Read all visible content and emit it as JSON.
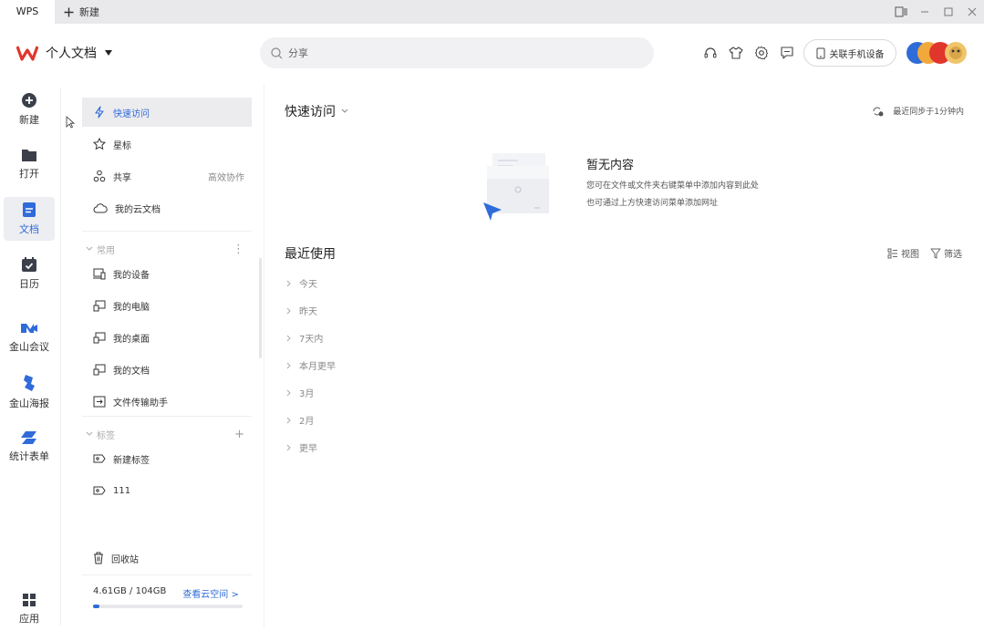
{
  "tabs": {
    "app_tab": "WPS",
    "new_tab": "新建"
  },
  "header": {
    "workspace": "个人文档",
    "search_placeholder": "分享",
    "link_phone": "关联手机设备"
  },
  "rail": [
    {
      "label": "新建",
      "icon": "plus-circle-icon"
    },
    {
      "label": "打开",
      "icon": "folder-icon"
    },
    {
      "label": "文档",
      "icon": "document-icon",
      "active": true
    },
    {
      "label": "日历",
      "icon": "calendar-icon"
    },
    {
      "label": "金山会议",
      "icon": "video-meeting-icon"
    },
    {
      "label": "金山海报",
      "icon": "poster-icon"
    },
    {
      "label": "统计表单",
      "icon": "form-icon"
    },
    {
      "label": "应用",
      "icon": "apps-grid-icon"
    }
  ],
  "sidebar": {
    "top_items": [
      {
        "label": "快速访问",
        "icon": "lightning-icon",
        "active": true
      },
      {
        "label": "星标",
        "icon": "star-icon"
      },
      {
        "label": "共享",
        "icon": "share-nodes-icon",
        "extra": "高效协作"
      },
      {
        "label": "我的云文档",
        "icon": "cloud-icon"
      }
    ],
    "common_group": "常用",
    "common_items": [
      {
        "label": "我的设备",
        "icon": "device-icon"
      },
      {
        "label": "我的电脑",
        "icon": "computer-icon"
      },
      {
        "label": "我的桌面",
        "icon": "desktop-icon"
      },
      {
        "label": "我的文档",
        "icon": "my-docs-icon"
      },
      {
        "label": "文件传输助手",
        "icon": "transfer-icon"
      }
    ],
    "tags_group": "标签",
    "tag_items": [
      {
        "label": "新建标签",
        "icon": "tag-icon"
      },
      {
        "label": "111",
        "icon": "tag-icon"
      }
    ],
    "recycle": "回收站",
    "storage": {
      "used": "4.61GB / 104GB",
      "link": "查看云空间 >",
      "fraction": 0.044
    }
  },
  "main": {
    "quick_access_title": "快速访问",
    "sync_status": "最近同步于1分钟内",
    "empty_title": "暂无内容",
    "empty_line1": "您可在文件或文件夹右键菜单中添加内容到此处",
    "empty_line2": "也可通过上方快速访问菜单添加网址",
    "recent_title": "最近使用",
    "view_label": "视图",
    "filter_label": "筛选",
    "groups": [
      "今天",
      "昨天",
      "7天内",
      "本月更早",
      "3月",
      "2月",
      "更早"
    ]
  },
  "colors": {
    "accent": "#2f6bd9",
    "brand_red": "#e0362c"
  }
}
